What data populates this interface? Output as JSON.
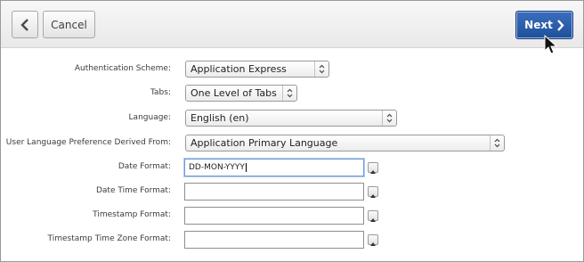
{
  "toolbar": {
    "back_icon": "chevron-left-icon",
    "cancel_label": "Cancel",
    "next_label": "Next",
    "next_icon": "chevron-right-icon",
    "accent_color": "#2a5ca8"
  },
  "form": {
    "authentication_scheme": {
      "label": "Authentication Scheme:",
      "value": "Application Express"
    },
    "tabs": {
      "label": "Tabs:",
      "value": "One Level of Tabs"
    },
    "language": {
      "label": "Language:",
      "value": "English (en)"
    },
    "user_language_pref": {
      "label": "User Language Preference Derived From:",
      "value": "Application Primary Language"
    },
    "date_format": {
      "label": "Date Format:",
      "value": "DD-MON-YYYY"
    },
    "date_time_format": {
      "label": "Date Time Format:",
      "value": ""
    },
    "timestamp_format": {
      "label": "Timestamp Format:",
      "value": ""
    },
    "timestamp_tz_format": {
      "label": "Timestamp Time Zone Format:",
      "value": ""
    }
  }
}
